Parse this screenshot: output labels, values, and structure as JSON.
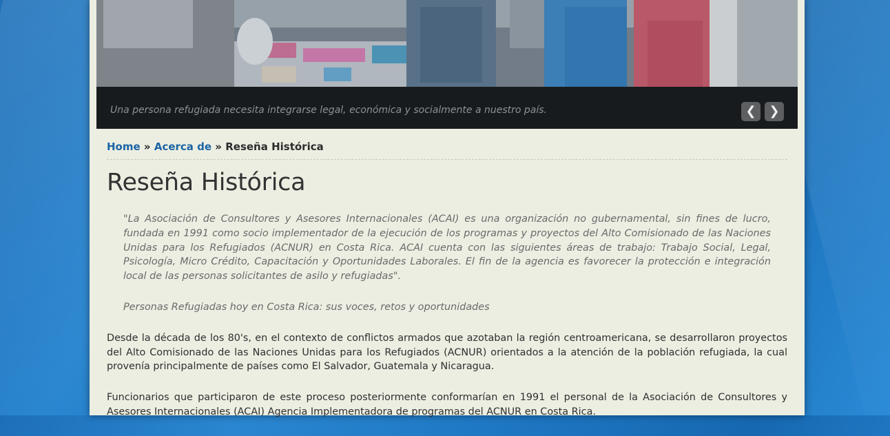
{
  "slider": {
    "caption": "Una persona refugiada necesita integrarse legal, económica y socialmente a nuestro país.",
    "prev_label": "❮",
    "next_label": "❯"
  },
  "breadcrumb": {
    "home": "Home",
    "separator_1": "»",
    "about": "Acerca de",
    "separator_2": "»",
    "current": "Reseña Histórica"
  },
  "page": {
    "title": "Reseña Histórica",
    "quote_1": "\"La Asociación de Consultores y Asesores Internacionales (ACAI) es una organización no gubernamental, sin fines de lucro, fundada en 1991 como socio implementador de la ejecución de los programas y proyectos del Alto Comisionado de las Naciones Unidas para los Refugiados (ACNUR) en Costa Rica. ACAI cuenta con las siguientes áreas de trabajo: Trabajo Social, Legal, Psicología, Micro Crédito, Capacitación y Oportunidades Laborales. El fin de la agencia es favorecer la protección e integración local de las personas solicitantes de asilo y refugiadas\".",
    "quote_2": "Personas Refugiadas hoy en Costa Rica: sus voces, retos y oportunidades",
    "paragraph_1": "Desde la década de los 80's, en el contexto de conflictos armados que azotaban la región centroamericana, se desarrollaron proyectos del Alto Comisionado de las Naciones Unidas para los Refugiados (ACNUR) orientados a la atención de la población refugiada, la cual provenía principalmente de países como El Salvador, Guatemala y Nicaragua.",
    "paragraph_2": "Funcionarios que participaron de este proceso posteriormente conformarían en 1991 el personal de la Asociación de Consultores y Asesores Internacionales (ACAI) Agencia Implementadora de programas del ACNUR en Costa Rica."
  },
  "colors": {
    "link": "#1b64a3",
    "page_background": "#eceee2",
    "body_background": "#1f78c4"
  }
}
